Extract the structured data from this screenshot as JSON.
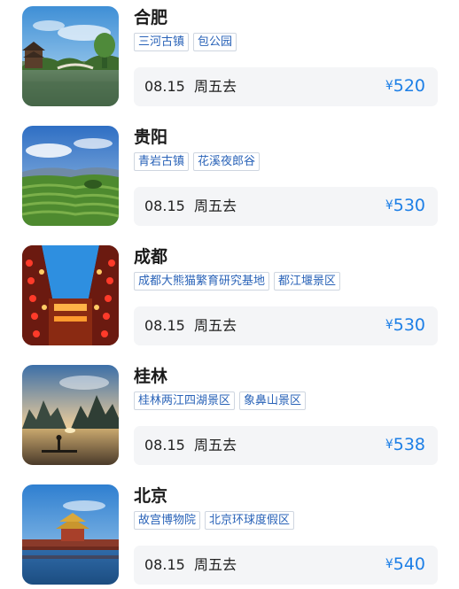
{
  "destinations": [
    {
      "city": "合肥",
      "tags": [
        "三河古镇",
        "包公园"
      ],
      "date": "08.15",
      "day": "周五去",
      "currency": "¥",
      "price": "520",
      "image": "hefei-pavilion-lake-photo"
    },
    {
      "city": "贵阳",
      "tags": [
        "青岩古镇",
        "花溪夜郎谷"
      ],
      "date": "08.15",
      "day": "周五去",
      "currency": "¥",
      "price": "530",
      "image": "guiyang-terraced-fields-photo"
    },
    {
      "city": "成都",
      "tags": [
        "成都大熊猫繁育研究基地",
        "都江堰景区"
      ],
      "date": "08.15",
      "day": "周五去",
      "currency": "¥",
      "price": "530",
      "image": "chengdu-lantern-street-photo"
    },
    {
      "city": "桂林",
      "tags": [
        "桂林两江四湖景区",
        "象鼻山景区"
      ],
      "date": "08.15",
      "day": "周五去",
      "currency": "¥",
      "price": "538",
      "image": "guilin-karst-river-photo"
    },
    {
      "city": "北京",
      "tags": [
        "故宫博物院",
        "北京环球度假区"
      ],
      "date": "08.15",
      "day": "周五去",
      "currency": "¥",
      "price": "540",
      "image": "beijing-forbidden-city-photo"
    }
  ]
}
